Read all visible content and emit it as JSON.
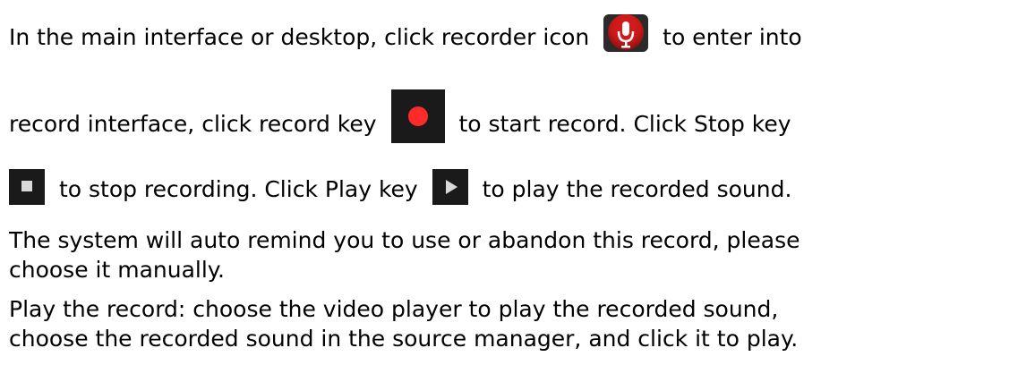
{
  "doc": {
    "lines": {
      "l1a": "In the main interface or desktop, click recorder icon",
      "l1b": "to enter into",
      "l2a": "record interface, click record key",
      "l2b": "to start record. Click Stop key",
      "l3a": "to stop recording. Click Play key",
      "l3b": "to play the recorded sound.",
      "l4": "The system will auto remind you to use or abandon this record, please",
      "l5": "choose it manually.",
      "l6": "Play the record: choose the video player to play the recorded sound,",
      "l7": "choose the recorded sound in the source manager, and click it to play."
    }
  },
  "icons": {
    "recorder": "microphone-icon",
    "record": "record-icon",
    "stop": "stop-icon",
    "play": "play-icon"
  },
  "colors": {
    "recorder_red": "#d21a1a",
    "record_dot": "#ff2a2a",
    "key_bg": "#1a1a1a"
  }
}
